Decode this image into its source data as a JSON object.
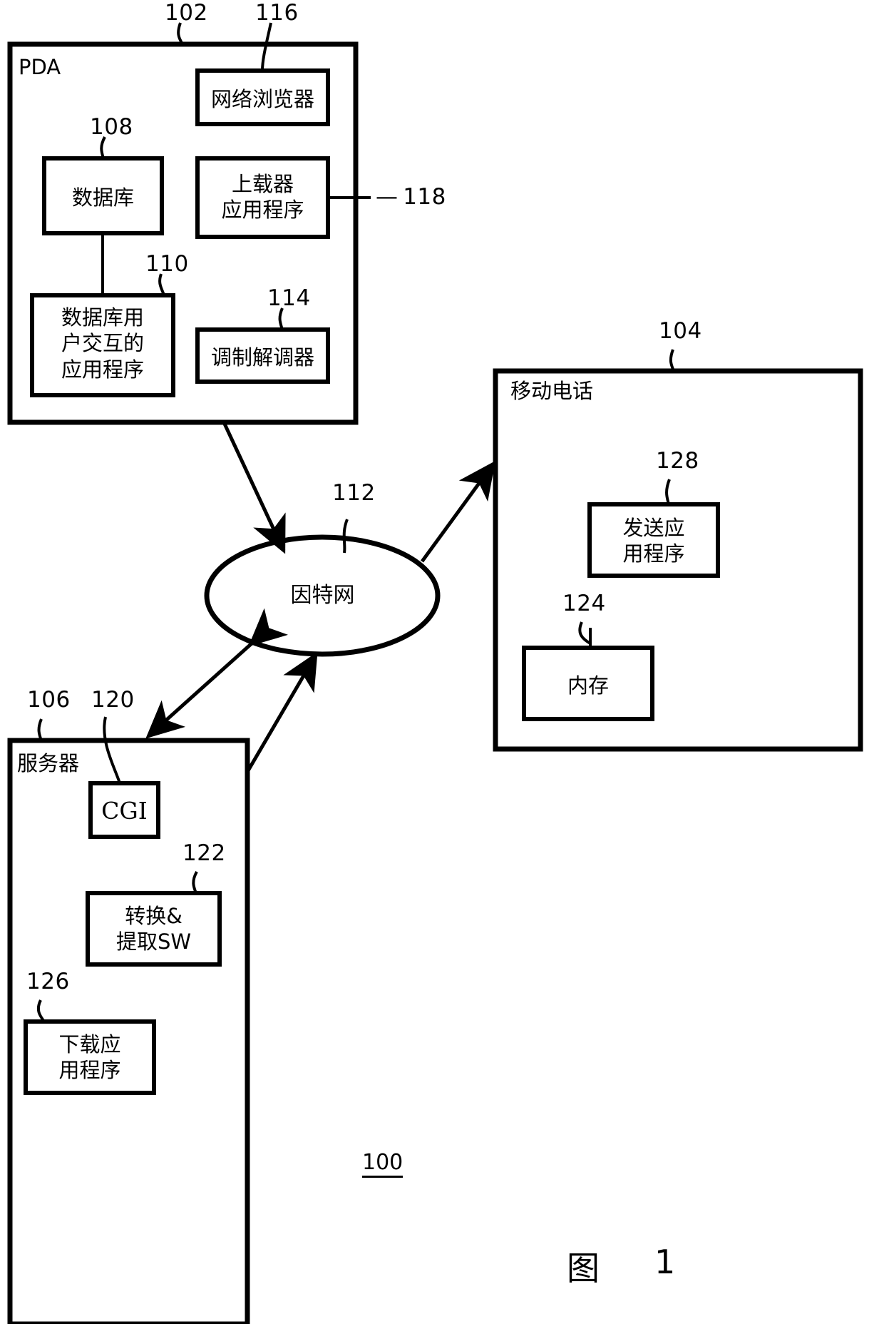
{
  "figure": {
    "title_prefix": "图",
    "title_number": "1",
    "system_ref": "100"
  },
  "nodes": {
    "pda": {
      "ref": "102",
      "label": "PDA",
      "children": {
        "web_browser": {
          "ref": "116",
          "label": "网络浏览器"
        },
        "database": {
          "ref": "108",
          "label": "数据库"
        },
        "uploader_app": {
          "ref": "118",
          "label_line1": "上载器",
          "label_line2": "应用程序"
        },
        "db_user_app": {
          "ref": "110",
          "label_line1": "数据库用",
          "label_line2": "户交互的",
          "label_line3": "应用程序"
        },
        "modem": {
          "ref": "114",
          "label": "调制解调器"
        }
      }
    },
    "internet": {
      "ref": "112",
      "label": "因特网"
    },
    "mobile_phone": {
      "ref": "104",
      "label": "移动电话",
      "children": {
        "send_app": {
          "ref": "128",
          "label_line1": "发送应",
          "label_line2": "用程序"
        },
        "memory": {
          "ref": "124",
          "label": "内存"
        }
      }
    },
    "server": {
      "ref": "106",
      "label": "服务器",
      "children": {
        "cgi": {
          "ref": "120",
          "label": "CGI"
        },
        "convert_extract_sw": {
          "ref": "122",
          "label_line1": "转换&",
          "label_line2": "提取SW"
        },
        "download_app": {
          "ref": "126",
          "label_line1": "下载应",
          "label_line2": "用程序"
        }
      }
    }
  },
  "connectors": [
    {
      "name": "pda-to-internet",
      "kind": "arrow-single",
      "from": "pda",
      "to": "internet"
    },
    {
      "name": "internet-to-mobile-phone",
      "kind": "arrow-single",
      "from": "internet",
      "to": "mobile_phone"
    },
    {
      "name": "internet-to-server",
      "kind": "arrow-double",
      "from": "internet",
      "to": "server"
    },
    {
      "name": "server-to-internet",
      "kind": "arrow-single",
      "from": "server",
      "to": "internet"
    },
    {
      "name": "database-to-db-user-app",
      "kind": "line",
      "from": "database",
      "to": "db_user_app"
    },
    {
      "name": "mobile-phone-to-memory",
      "kind": "line",
      "from": "mobile_phone",
      "to": "memory"
    }
  ],
  "style": {
    "ink": "#000000",
    "paper": "#ffffff"
  }
}
